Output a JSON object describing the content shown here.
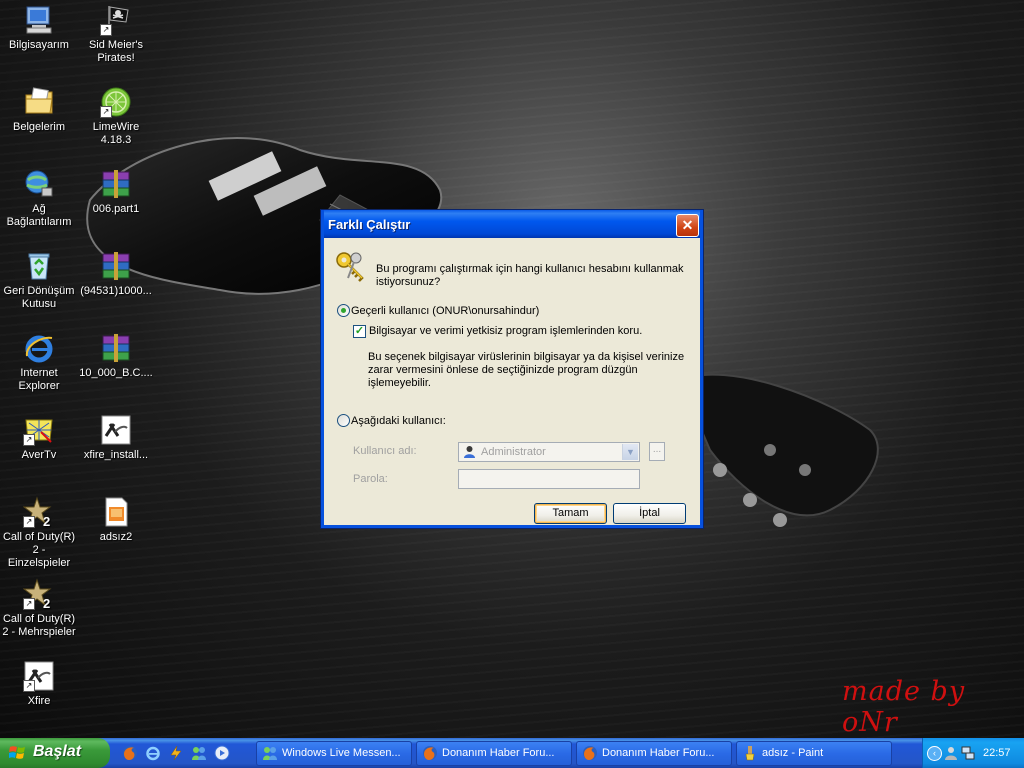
{
  "desktop": {
    "icons": [
      {
        "label": "Bilgisayarım",
        "icon": "my-computer-icon"
      },
      {
        "label": "Sid Meier's\nPirates!",
        "icon": "pirate-flag-icon"
      },
      {
        "label": "Belgelerim",
        "icon": "my-documents-icon"
      },
      {
        "label": "LimeWire\n4.18.3",
        "icon": "limewire-icon"
      },
      {
        "label": "Ağ\nBağlantılarım",
        "icon": "network-icon"
      },
      {
        "label": "006.part1",
        "icon": "winrar-archive-icon"
      },
      {
        "label": "Geri Dönüşüm\nKutusu",
        "icon": "recycle-bin-icon"
      },
      {
        "label": "(94531)1000...",
        "icon": "winrar-archive-icon"
      },
      {
        "label": "Internet\nExplorer",
        "icon": "internet-explorer-icon"
      },
      {
        "label": "10_000_B.C....",
        "icon": "winrar-archive-icon"
      },
      {
        "label": "AverTv",
        "icon": "avertv-icon"
      },
      {
        "label": "xfire_install...",
        "icon": "xfire-icon"
      },
      {
        "label": "Call of Duty(R)\n2 - Einzelspieler",
        "icon": "call-of-duty-icon"
      },
      {
        "label": "adsız2",
        "icon": "paint-image-icon"
      },
      {
        "label": "Call of Duty(R)\n2 - Mehrspieler",
        "icon": "call-of-duty-icon"
      },
      {
        "label": "Xfire",
        "icon": "xfire-icon"
      }
    ],
    "watermark": "made by oNr"
  },
  "dialog": {
    "title": "Farklı Çalıştır",
    "close_symbol": "✕",
    "question": "Bu programı çalıştırmak için hangi kullanıcı hesabını kullanmak istiyorsunuz?",
    "current_user_label": "Geçerli kullanıcı (ONUR\\onursahindur)",
    "current_user_selected": true,
    "protect_label": "Bilgisayar ve verimi yetkisiz program işlemlerinden koru.",
    "protect_checked": true,
    "protect_description": "Bu seçenek bilgisayar virüslerinin bilgisayar ya da kişisel verinize zarar vermesini önlese de seçtiğinizde program düzgün işlemeyebilir.",
    "other_user_label": "Aşağıdaki kullanıcı:",
    "other_user_selected": false,
    "username_label": "Kullanıcı adı:",
    "username_value": "Administrator",
    "browse_label": "...",
    "password_label": "Parola:",
    "password_value": "",
    "ok_label": "Tamam",
    "cancel_label": "İptal"
  },
  "taskbar": {
    "start_label": "Başlat",
    "quick_launch": [
      "firefox-icon",
      "internet-explorer-icon",
      "winamp-icon",
      "msn-messenger-icon",
      "media-player-icon"
    ],
    "tasks": [
      {
        "label": "Windows Live Messen...",
        "icon": "msn-messenger-icon"
      },
      {
        "label": "Donanım Haber Foru...",
        "icon": "firefox-icon"
      },
      {
        "label": "Donanım Haber Foru...",
        "icon": "firefox-icon"
      },
      {
        "label": "adsız - Paint",
        "icon": "paint-icon"
      }
    ],
    "clock": "22:57"
  }
}
